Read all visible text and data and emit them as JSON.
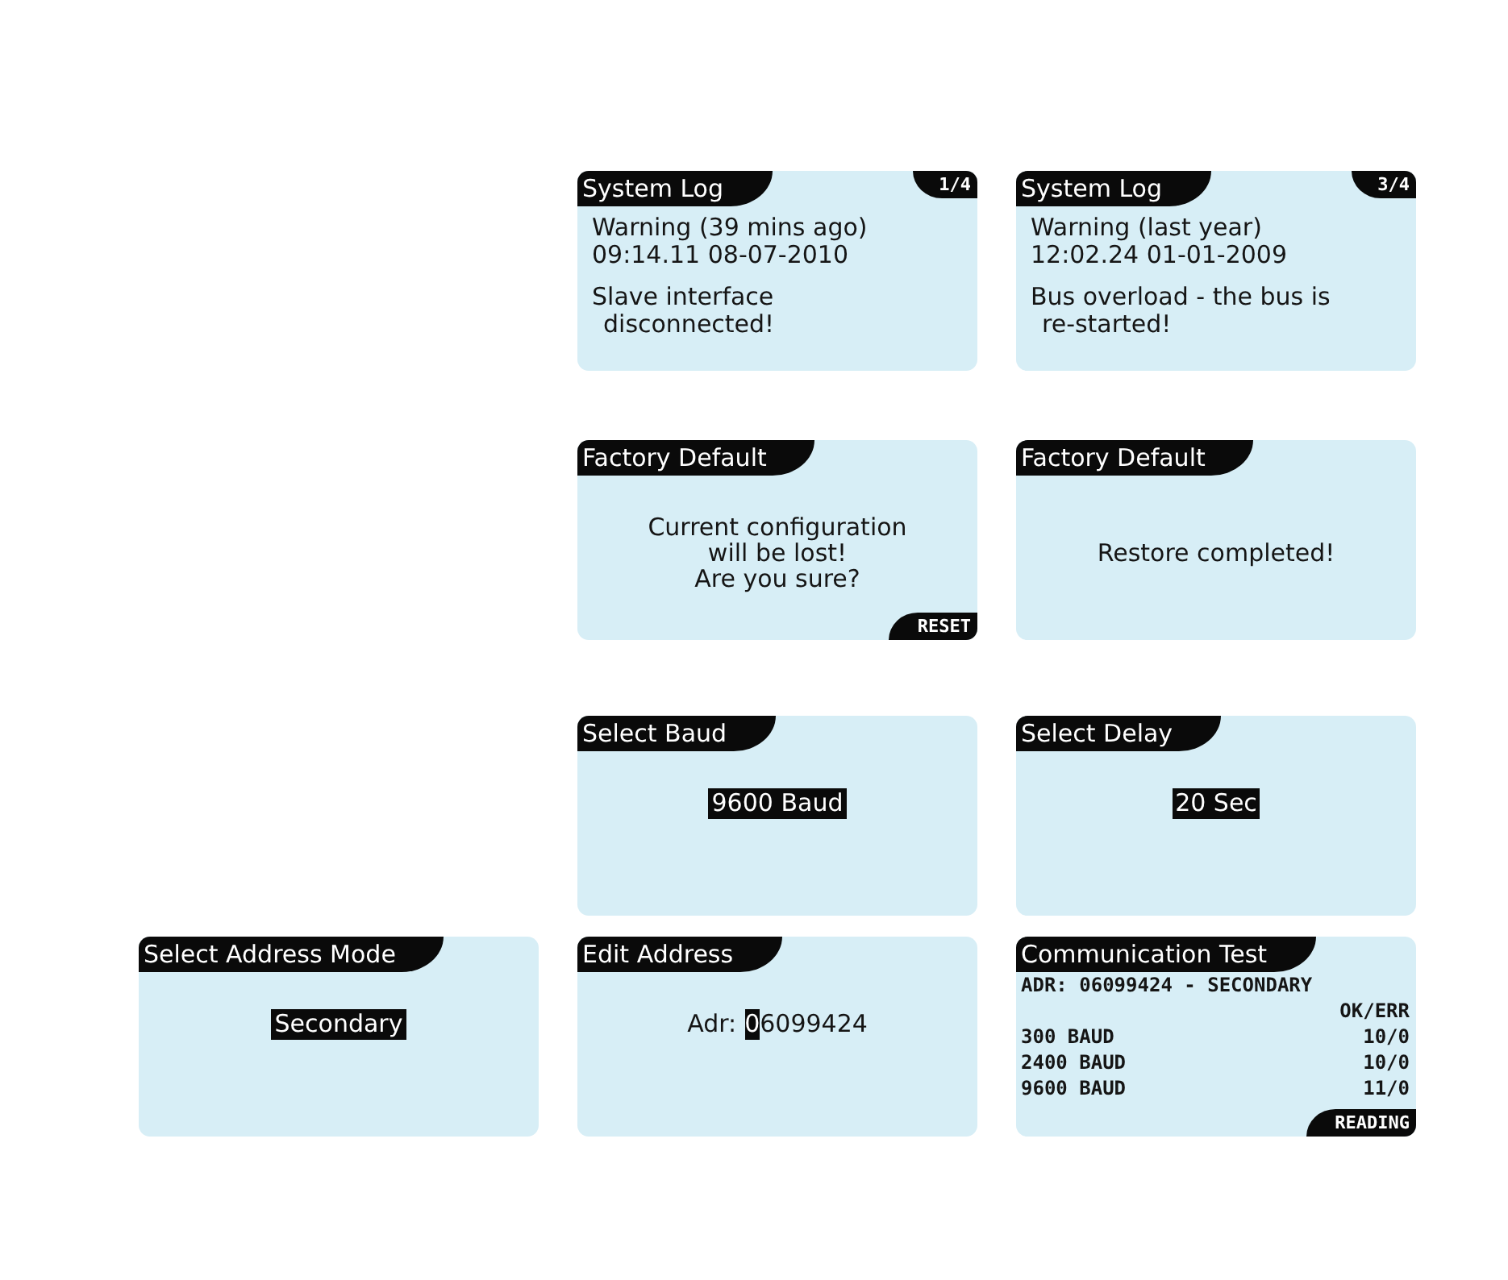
{
  "rows": [
    {
      "screens": [
        {
          "kind": "log",
          "title": "System Log",
          "page": "1/4",
          "heading": "Warning (39 mins ago)",
          "timestamp": "09:14.11 08-07-2010",
          "message_lines": [
            "Slave interface",
            "disconnected!"
          ]
        },
        {
          "kind": "log",
          "title": "System Log",
          "page": "3/4",
          "heading": "Warning (last year)",
          "timestamp": "12:02.24 01-01-2009",
          "message_lines": [
            "Bus overload - the bus is",
            "re-started!"
          ]
        }
      ]
    },
    {
      "screens": [
        {
          "kind": "confirm",
          "title": "Factory Default",
          "lines": [
            "Current configuration",
            "will be lost!",
            "Are you sure?"
          ],
          "softkey": "RESET"
        },
        {
          "kind": "message",
          "title": "Factory Default",
          "text": "Restore completed!"
        }
      ]
    },
    {
      "screens": [
        {
          "kind": "select",
          "title": "Select Baud",
          "value": "9600 Baud"
        },
        {
          "kind": "select",
          "title": "Select Delay",
          "value": "20 Sec"
        }
      ]
    },
    {
      "screens": [
        {
          "kind": "select",
          "title": "Select Address Mode",
          "value": "Secondary"
        },
        {
          "kind": "edit",
          "title": "Edit Address",
          "label": "Adr:",
          "cursor_digit": "0",
          "remaining_digits": "6099424"
        },
        {
          "kind": "test",
          "title": "Communication Test",
          "address_line": "ADR: 06099424 - SECONDARY",
          "result_header": "OK/ERR",
          "results": [
            {
              "rate": "300 BAUD",
              "result": "10/0"
            },
            {
              "rate": "2400 BAUD",
              "result": "10/0"
            },
            {
              "rate": "9600 BAUD",
              "result": "11/0"
            }
          ],
          "softkey": "READING"
        }
      ]
    }
  ]
}
